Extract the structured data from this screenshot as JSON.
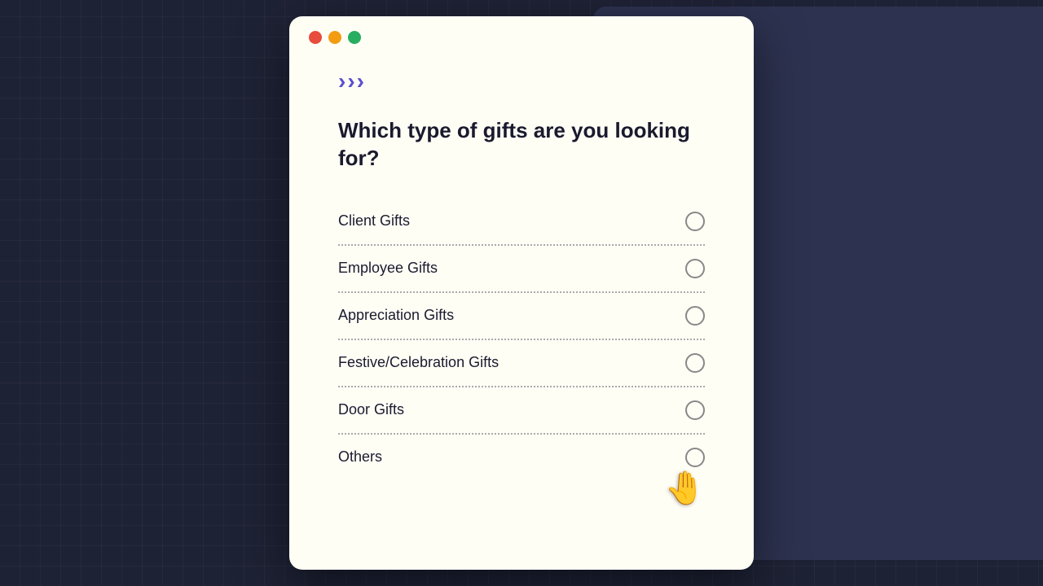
{
  "window": {
    "traffic_lights": [
      {
        "color": "red",
        "class": "tl-red"
      },
      {
        "color": "yellow",
        "class": "tl-yellow"
      },
      {
        "color": "green",
        "class": "tl-green"
      }
    ]
  },
  "logo": {
    "chevrons": [
      "›",
      "›",
      "›"
    ]
  },
  "question": {
    "text": "Which type of gifts are you looking for?"
  },
  "options": [
    {
      "label": "Client Gifts",
      "id": "client-gifts"
    },
    {
      "label": "Employee Gifts",
      "id": "employee-gifts"
    },
    {
      "label": "Appreciation Gifts",
      "id": "appreciation-gifts"
    },
    {
      "label": "Festive/Celebration Gifts",
      "id": "festive-gifts"
    },
    {
      "label": "Door Gifts",
      "id": "door-gifts"
    },
    {
      "label": "Others",
      "id": "others"
    }
  ],
  "cursor": {
    "symbol": "🖐"
  }
}
